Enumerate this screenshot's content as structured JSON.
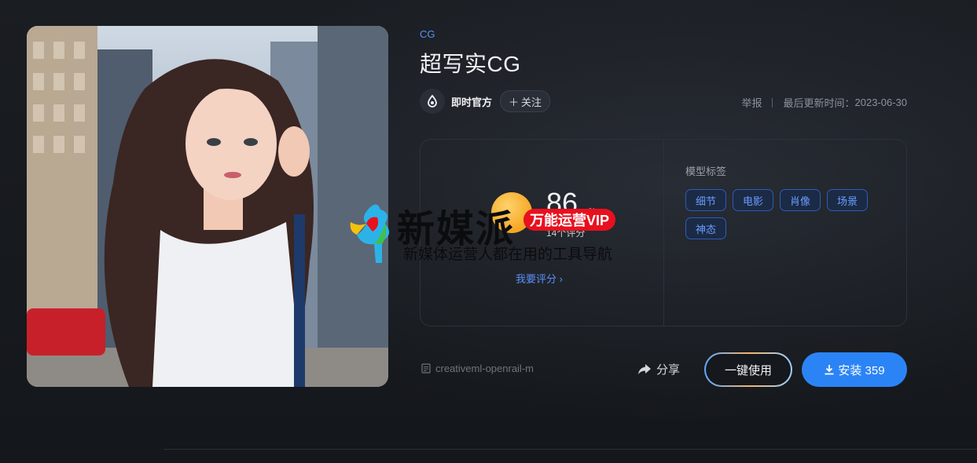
{
  "model": {
    "category": "CG",
    "title": "超写实CG",
    "author": {
      "name": "即时官方",
      "follow_label": "关注"
    },
    "report_label": "举报",
    "update_label": "最后更新时间：",
    "update_date": "2023-06-30"
  },
  "rating": {
    "score": "86",
    "unit": "%",
    "review_count": "14个评分",
    "rate_link": "我要评分"
  },
  "tags": {
    "label": "模型标签",
    "items": [
      "细节",
      "电影",
      "肖像",
      "场景",
      "神态"
    ]
  },
  "actions": {
    "license": "creativeml-openrail-m",
    "share_label": "分享",
    "use_label": "一键使用",
    "install_label": "安装 359"
  },
  "watermark": {
    "brand": "新媒派",
    "vip": "万能运营VIP",
    "slogan": "新媒体运营人都在用的工具导航"
  },
  "colors": {
    "accent": "#2b84f6",
    "tag_text": "#6a9cff",
    "rating_badge": "#f5a623",
    "watermark_badge": "#e8101e"
  }
}
